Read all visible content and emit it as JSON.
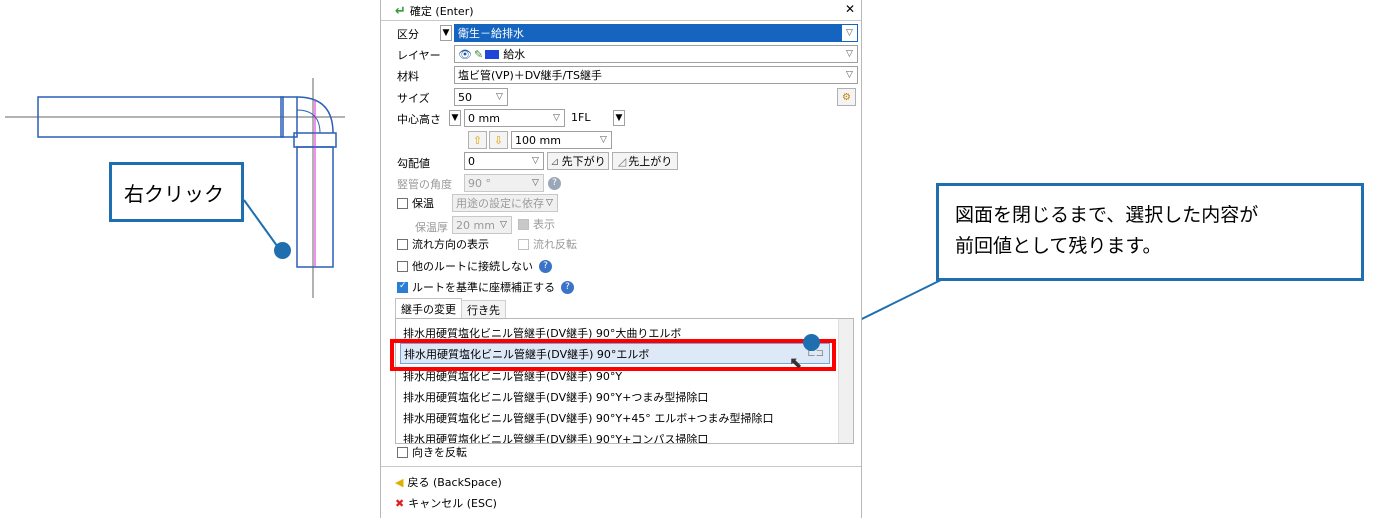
{
  "callouts": {
    "right_click": "右クリック",
    "note_line1": "図面を閉じるまで、選択した内容が",
    "note_line2": "前回値として残ります。"
  },
  "panel": {
    "confirm": "確定 (Enter)",
    "close_glyph": "✕",
    "category": {
      "label": "区分",
      "value": "衛生－給排水"
    },
    "layer": {
      "label": "レイヤー",
      "value": "給水"
    },
    "material": {
      "label": "材料",
      "value": "塩ビ管(VP)＋DV継手/TS継手"
    },
    "size": {
      "label": "サイズ",
      "value": "50"
    },
    "center_height": {
      "label": "中心高さ",
      "value": "0 mm",
      "floor": "1FL",
      "step": "100 mm"
    },
    "slope": {
      "label": "勾配値",
      "value": "0",
      "down_btn": "先下がり",
      "up_btn": "先上がり"
    },
    "riser_angle": {
      "label": "竪管の角度",
      "value": "90 °"
    },
    "insulation": {
      "label": "保温",
      "value": "用途の設定に依存"
    },
    "insulation_thickness": {
      "label": "保温厚",
      "value": "20 mm",
      "show": "表示"
    },
    "flow_direction": "流れ方向の表示",
    "flow_reverse": "流れ反転",
    "no_connect": "他のルートに接続しない",
    "coord_correct": "ルートを基準に座標補正する",
    "tabs": {
      "fitting_change": "継手の変更",
      "destination": "行き先"
    },
    "fittings": [
      "排水用硬質塩化ビニル管継手(DV継手) 90°大曲りエルボ",
      "排水用硬質塩化ビニル管継手(DV継手) 90°エルボ",
      "排水用硬質塩化ビニル管継手(DV継手) 90°Y",
      "排水用硬質塩化ビニル管継手(DV継手) 90°Y+つまみ型掃除口",
      "排水用硬質塩化ビニル管継手(DV継手) 90°Y+45° エルボ+つまみ型掃除口",
      "排水用硬質塩化ビニル管継手(DV継手) 90°Y+コンパス掃除口"
    ],
    "reverse_direction": "向きを反転",
    "back": "戻る (BackSpace)",
    "cancel": "キャンセル (ESC)"
  },
  "colors": {
    "callout_border": "#1f6fb0",
    "highlight": "#ff0000",
    "accent": "#2a7fd4",
    "pipe_stroke": "#2b5fb8",
    "centerline": "#e020e0"
  }
}
